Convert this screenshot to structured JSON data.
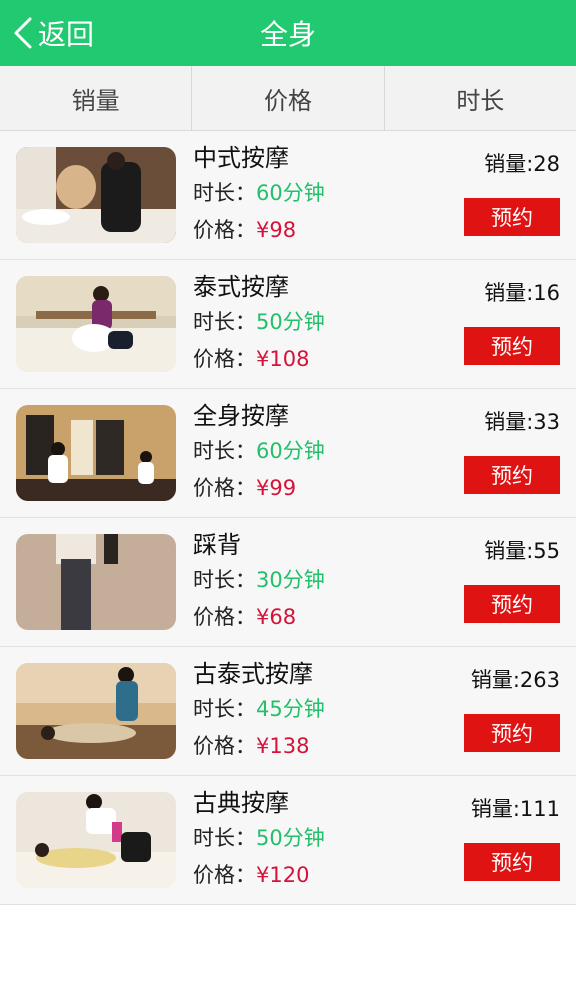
{
  "colors": {
    "header_bg": "#21c970",
    "duration_text": "#22c06a",
    "price_text": "#d4123a",
    "book_button": "#e01313"
  },
  "header": {
    "back_label": "返回",
    "title": "全身",
    "back_icon": "chevron-left-icon"
  },
  "sort_tabs": [
    {
      "label": "销量"
    },
    {
      "label": "价格"
    },
    {
      "label": "时长"
    }
  ],
  "labels": {
    "duration_prefix": "时长：",
    "price_prefix": "价格：",
    "book": "预约"
  },
  "items": [
    {
      "name": "中式按摩",
      "duration": "60分钟",
      "price": "¥98",
      "sales": "销量:28"
    },
    {
      "name": "泰式按摩",
      "duration": "50分钟",
      "price": "¥108",
      "sales": "销量:16"
    },
    {
      "name": "全身按摩",
      "duration": "60分钟",
      "price": "¥99",
      "sales": "销量:33"
    },
    {
      "name": "踩背",
      "duration": "30分钟",
      "price": "¥68",
      "sales": "销量:55"
    },
    {
      "name": "古泰式按摩",
      "duration": "45分钟",
      "price": "¥138",
      "sales": "销量:263"
    },
    {
      "name": "古典按摩",
      "duration": "50分钟",
      "price": "¥120",
      "sales": "销量:111"
    }
  ]
}
